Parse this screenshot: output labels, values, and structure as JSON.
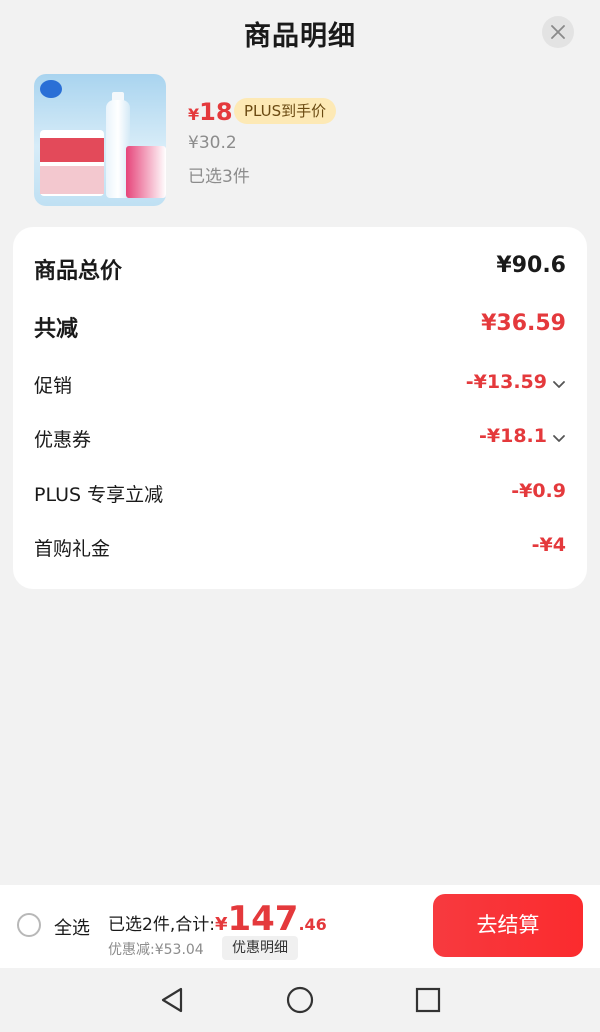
{
  "header": {
    "title": "商品明细"
  },
  "product": {
    "price_currency": "¥",
    "price_value": "18",
    "plus_tag": "PLUS到手价",
    "original_price": "¥30.2",
    "selected_count": "已选3件"
  },
  "details": {
    "total_label": "商品总价",
    "total_value": "¥90.6",
    "reduction_label": "共减",
    "reduction_value": "¥36.59",
    "promo_label": "促销",
    "promo_value": "-¥13.59",
    "coupon_label": "优惠券",
    "coupon_value": "-¥18.1",
    "plus_label": "PLUS 专享立减",
    "plus_value": "-¥0.9",
    "first_label": "首购礼金",
    "first_value": "-¥4"
  },
  "bottom_bar": {
    "select_all": "全选",
    "sum_label": "已选2件,合计:",
    "sum_yen": "¥",
    "sum_integer": "147",
    "sum_decimal": ".46",
    "discount_text": "优惠减:¥53.04",
    "detail_chip": "优惠明细",
    "checkout": "去结算"
  },
  "colors": {
    "accent_red": "#e4393c",
    "plus_tag_bg": "#fde9b5",
    "page_bg": "#f2f2f2"
  },
  "icons": {
    "close": "close-icon",
    "chevron": "chevron-down-icon",
    "nav_back": "nav-back-icon",
    "nav_home": "nav-home-icon",
    "nav_recent": "nav-recent-icon"
  }
}
